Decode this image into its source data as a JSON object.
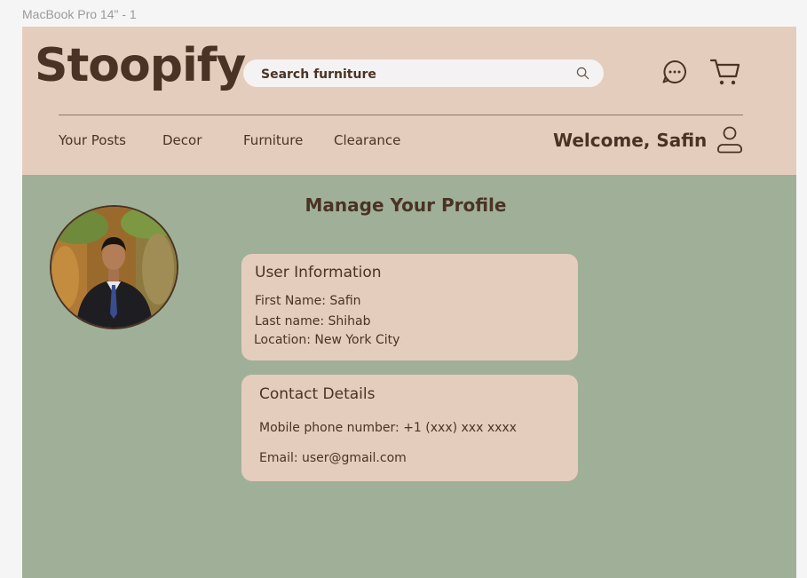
{
  "frame": {
    "label": "MacBook Pro 14\" - 1"
  },
  "header": {
    "logo": "Stoopify",
    "search": {
      "placeholder": "Search furniture",
      "value": ""
    },
    "icons": {
      "chat": "chat-bubble-icon",
      "cart": "shopping-cart-icon",
      "search": "magnifier-icon",
      "user": "user-profile-icon"
    },
    "nav": [
      {
        "label": "Your Posts"
      },
      {
        "label": "Decor"
      },
      {
        "label": "Furniture"
      },
      {
        "label": "Clearance"
      }
    ],
    "welcome": "Welcome, Safin"
  },
  "main": {
    "title": "Manage Your Profile",
    "user_info": {
      "title": "User Information",
      "first_name": "First Name: Safin",
      "last_name": "Last name: Shihab",
      "location": "Location: New York City"
    },
    "contact": {
      "title": "Contact Details",
      "phone": "Mobile phone number: +1 (xxx) xxx xxxx",
      "email": "Email: user@gmail.com"
    }
  },
  "colors": {
    "header_bg": "#e4cdbd",
    "main_bg": "#a0b098",
    "text": "#4a3325",
    "card_bg": "#e4cdbd"
  }
}
